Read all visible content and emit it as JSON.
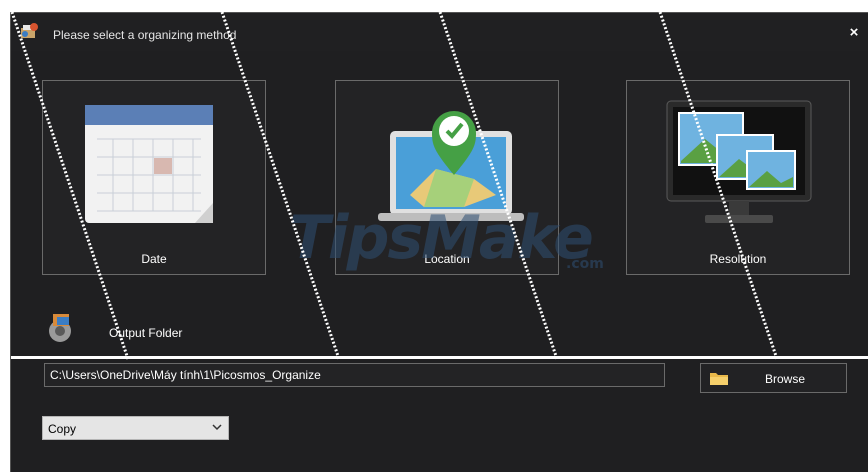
{
  "window": {
    "title": "Please select a organizing method",
    "close_symbol": "×",
    "app_icon": "picosmos-icon"
  },
  "methods": [
    {
      "label": "Date",
      "icon": "calendar-icon"
    },
    {
      "label": "Location",
      "icon": "laptop-map-pin-icon"
    },
    {
      "label": "Resolution",
      "icon": "monitor-photos-icon"
    }
  ],
  "watermark": {
    "text": "TipsMake",
    "suffix": ".com"
  },
  "output": {
    "label": "Output Folder",
    "icon": "gears-icon",
    "path": "C:\\Users\\OneDrive\\Máy tính\\1\\Picosmos_Organize",
    "browse_label": "Browse",
    "browse_icon": "folder-icon",
    "mode_selected": "Copy"
  },
  "colors": {
    "background": "#1f1f21",
    "tile_border": "#6a6a6a",
    "text": "#ffffff",
    "select_bg": "#e5e5e5"
  }
}
